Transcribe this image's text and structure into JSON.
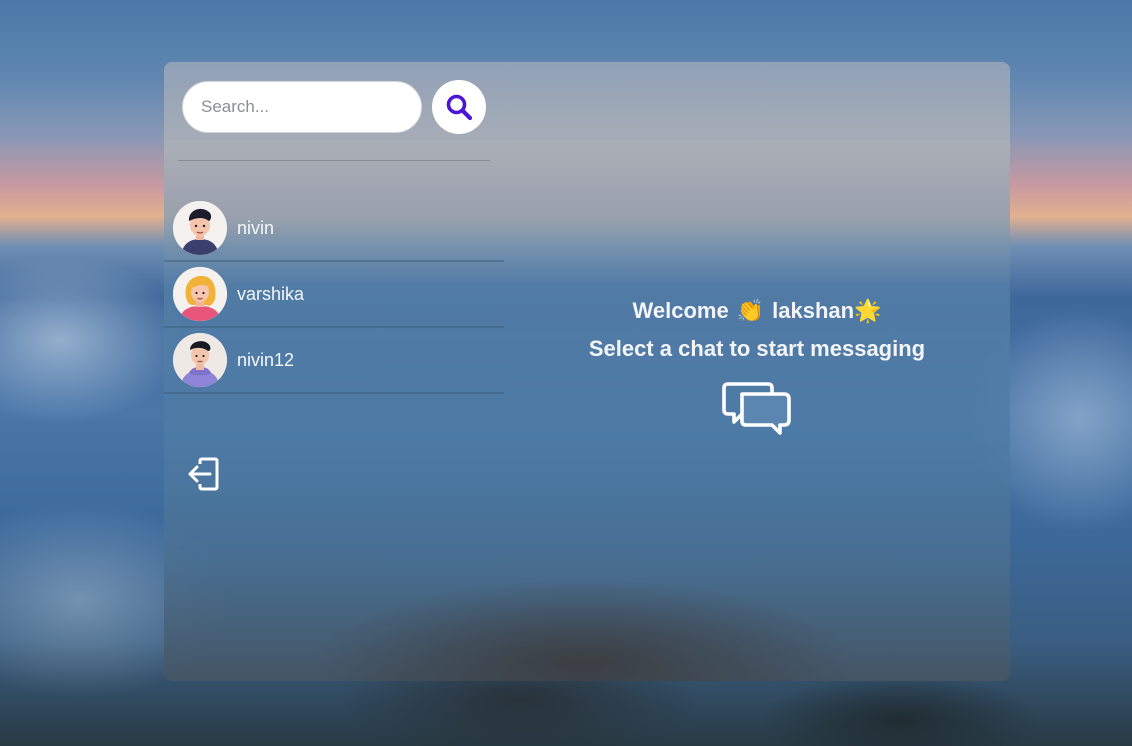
{
  "search": {
    "placeholder": "Search...",
    "value": ""
  },
  "users": [
    {
      "name": "nivin"
    },
    {
      "name": "varshika"
    },
    {
      "name": "nivin12"
    }
  ],
  "welcome": {
    "greeting": "Welcome",
    "wave_emoji": "👏",
    "username": "lakshan",
    "star_emoji": "🌟",
    "subtitle": "Select a chat to start messaging"
  },
  "icons": {
    "search": "search-icon",
    "logout": "logout-icon",
    "chat": "chat-bubbles-icon"
  },
  "colors": {
    "search_icon": "#4a16d6",
    "text": "#f3f5f8"
  }
}
